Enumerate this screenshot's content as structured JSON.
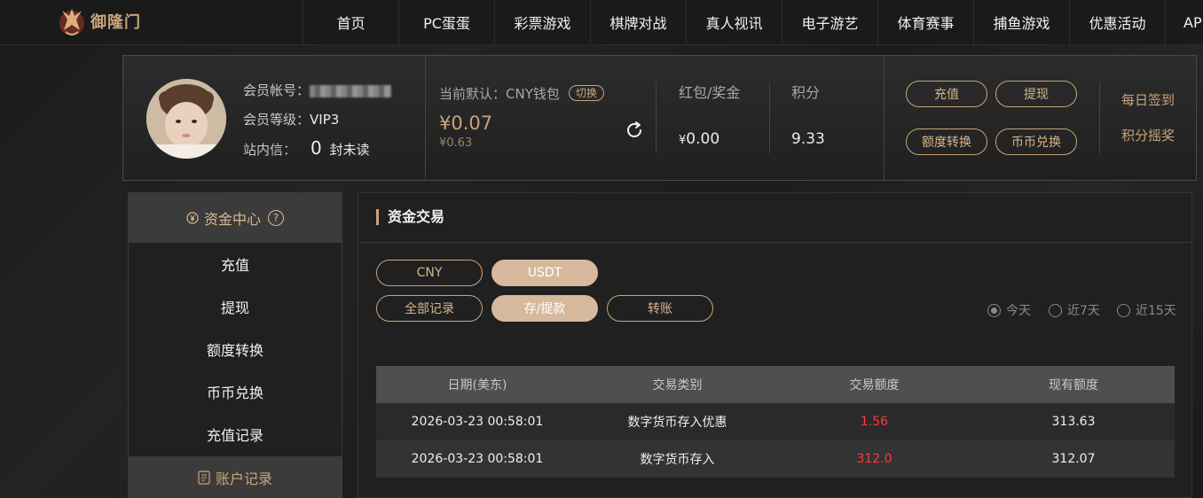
{
  "brand": {
    "logo_text": "御隆门"
  },
  "nav": {
    "items": [
      "首页",
      "PC蛋蛋",
      "彩票游戏",
      "棋牌对战",
      "真人视讯",
      "电子游艺",
      "体育赛事",
      "捕鱼游戏",
      "优惠活动",
      "AP"
    ]
  },
  "account": {
    "member_account_label": "会员帐号：",
    "member_level_label": "会员等级：",
    "member_level_value": "VIP3",
    "inbox_label": "站内信：",
    "unread_count": "0",
    "unread_suffix": "封未读"
  },
  "wallet": {
    "default_label": "当前默认：CNY钱包",
    "switch_label": "切换",
    "balance": "¥0.07",
    "sub_balance": "¥0.63"
  },
  "bonus": {
    "label": "红包/奖金",
    "currency": "¥",
    "value": "0.00"
  },
  "points": {
    "label": "积分",
    "value": "9.33"
  },
  "quick_actions": {
    "recharge": "充值",
    "withdraw": "提现",
    "quota_transfer": "额度转换",
    "coin_exchange": "币币兑换",
    "daily_checkin": "每日签到",
    "points_lottery": "积分摇奖"
  },
  "sidebar": {
    "header": "资金中心",
    "header_help": "?",
    "items": [
      "充值",
      "提现",
      "额度转换",
      "币币兑换",
      "充值记录"
    ],
    "footer": "账户记录"
  },
  "main": {
    "title": "资金交易",
    "currency_tabs": [
      "CNY",
      "USDT"
    ],
    "active_currency": "USDT",
    "record_tabs": [
      "全部记录",
      "存/提款",
      "转账"
    ],
    "active_record_tab": "存/提款",
    "date_filters": [
      "今天",
      "近7天",
      "近15天"
    ],
    "selected_date_filter": "今天",
    "table": {
      "headers": [
        "日期(美东)",
        "交易类别",
        "交易额度",
        "现有额度"
      ],
      "rows": [
        [
          "2026-03-23 00:58:01",
          "数字货币存入优惠",
          "1.56",
          "313.63"
        ],
        [
          "2026-03-23 00:58:01",
          "数字货币存入",
          "312.0",
          "312.07"
        ]
      ]
    }
  },
  "colors": {
    "accent_gold": "#c9a47a",
    "active_pill": "#d6b99c",
    "amount_red": "#ff3b3b",
    "background": "#1e1e1e"
  }
}
